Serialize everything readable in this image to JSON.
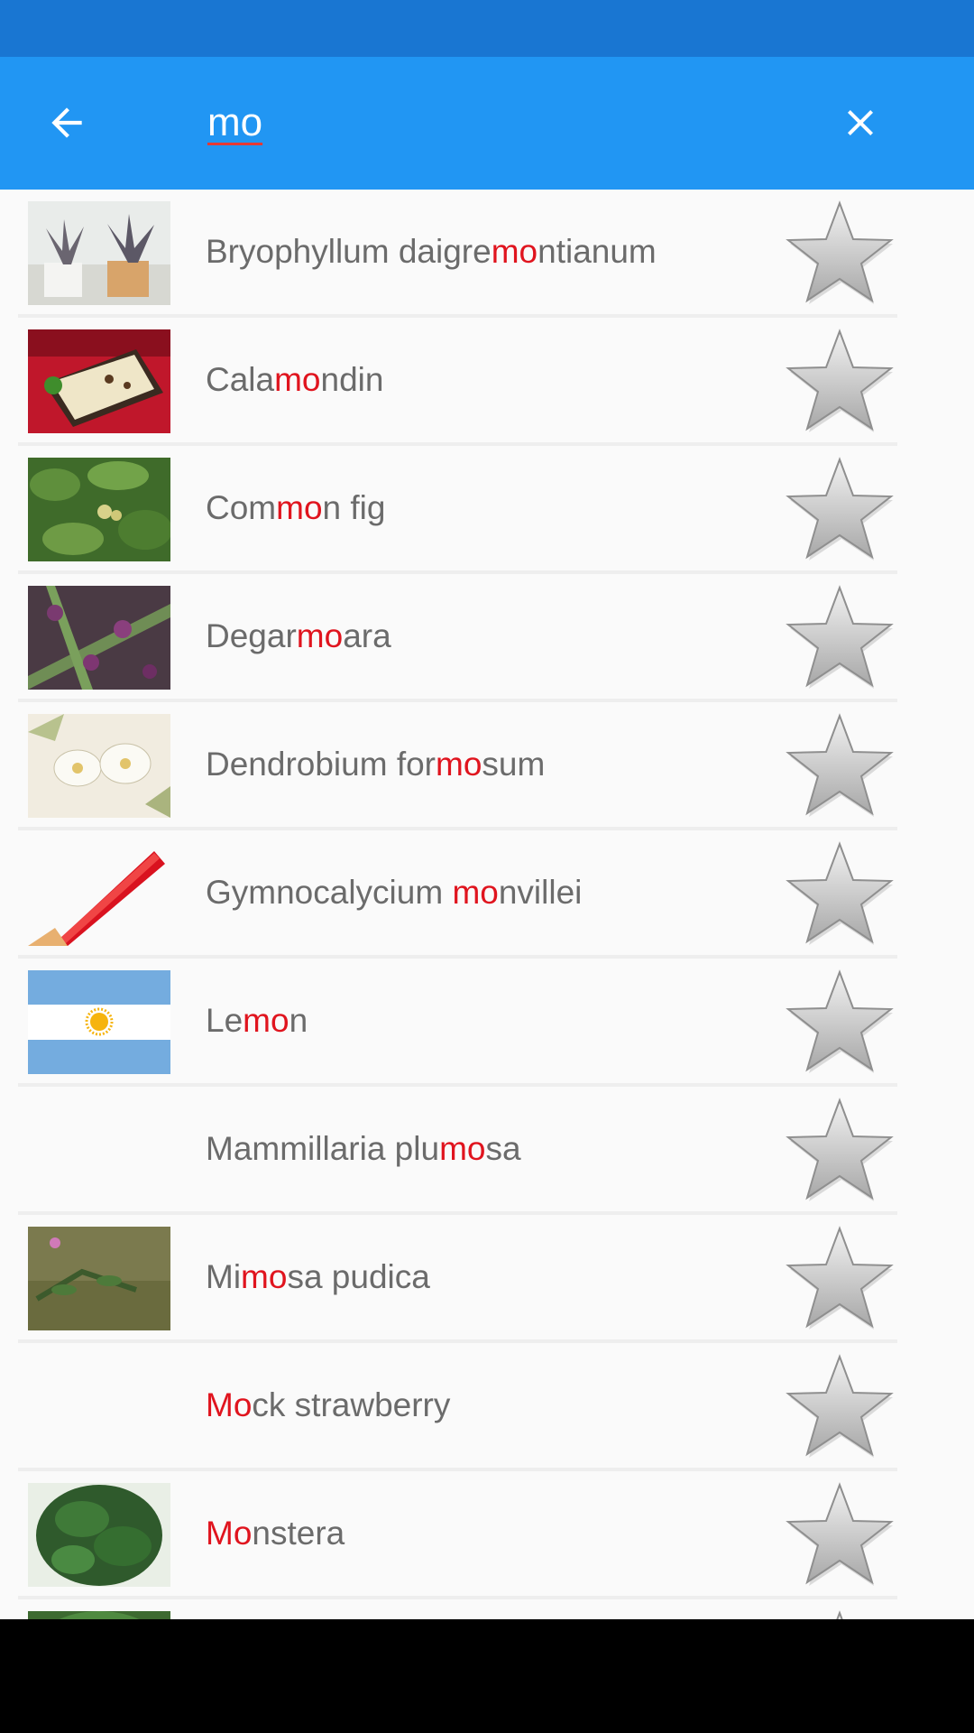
{
  "search": {
    "query": "mo"
  },
  "results": [
    {
      "pre": "Bryophyllum daigre",
      "hl": "mo",
      "post": "ntianum",
      "thumb": "potted-succulents-thumbnail"
    },
    {
      "pre": "Cala",
      "hl": "mo",
      "post": "ndin",
      "thumb": "dish-on-red-table-thumbnail"
    },
    {
      "pre": "Com",
      "hl": "mo",
      "post": "n fig",
      "thumb": "fig-leaves-thumbnail"
    },
    {
      "pre": "Degar",
      "hl": "mo",
      "post": "ara",
      "thumb": "purple-orchid-thumbnail"
    },
    {
      "pre": "Dendrobium for",
      "hl": "mo",
      "post": "sum",
      "thumb": "white-orchid-illustration-thumbnail"
    },
    {
      "pre": "Gymnocalycium ",
      "hl": "mo",
      "post": "nvillei",
      "thumb": "red-pencil-thumbnail"
    },
    {
      "pre": "Le",
      "hl": "mo",
      "post": "n",
      "thumb": "argentina-flag-thumbnail"
    },
    {
      "pre": "Mammillaria plu",
      "hl": "mo",
      "post": "sa",
      "thumb": ""
    },
    {
      "pre": "Mi",
      "hl": "mo",
      "post": "sa pudica",
      "thumb": "mimosa-on-grass-thumbnail"
    },
    {
      "pre": "",
      "hl": "Mo",
      "post": "ck strawberry",
      "thumb": ""
    },
    {
      "pre": "",
      "hl": "Mo",
      "post": "nstera",
      "thumb": "monstera-plant-thumbnail"
    },
    {
      "pre": "",
      "hl": "",
      "post": "",
      "thumb": "plant-thumbnail"
    }
  ],
  "icons": {
    "back": "arrow-left-icon",
    "clear": "close-icon",
    "favorite": "star-outline-icon"
  },
  "colors": {
    "appbar": "#2196f3",
    "statusbar": "#1976d2",
    "highlight": "#e0141e",
    "text": "#6b6b6b"
  }
}
